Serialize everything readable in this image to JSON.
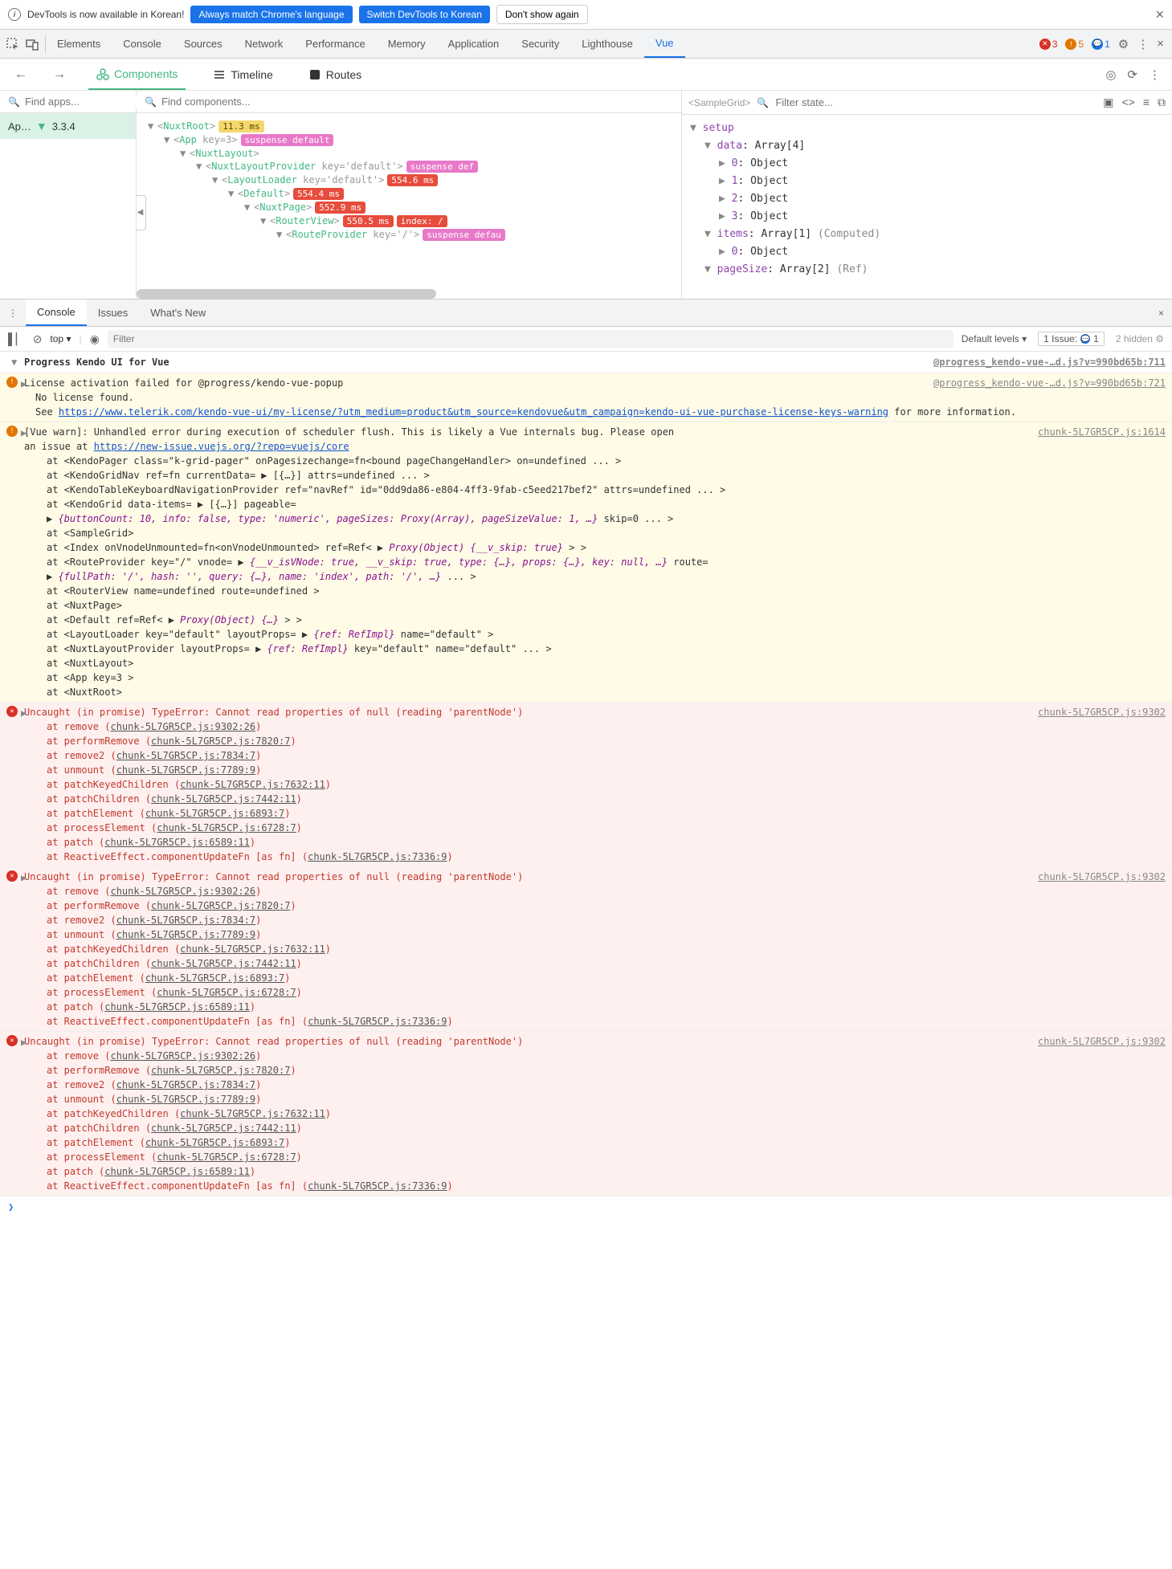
{
  "infobar": {
    "text": "DevTools is now available in Korean!",
    "btn1": "Always match Chrome's language",
    "btn2": "Switch DevTools to Korean",
    "btn3": "Don't show again"
  },
  "maintabs": [
    "Elements",
    "Console",
    "Sources",
    "Network",
    "Performance",
    "Memory",
    "Application",
    "Security",
    "Lighthouse",
    "Vue"
  ],
  "counts": {
    "err": "3",
    "warn": "5",
    "info": "1"
  },
  "vuetabs": {
    "components": "Components",
    "timeline": "Timeline",
    "routes": "Routes"
  },
  "leftSearch": "Find apps...",
  "midSearch": "Find components...",
  "appLabel": "Ap…",
  "appVer": "3.3.4",
  "tree": [
    {
      "indent": 0,
      "name": "NuxtRoot",
      "pills": [
        {
          "cls": "pill-yellow",
          "t": "11.3 ms"
        }
      ]
    },
    {
      "indent": 1,
      "name": "App",
      "key": "key=3",
      "pills": [
        {
          "cls": "pill-pink",
          "t": "suspense default"
        }
      ]
    },
    {
      "indent": 2,
      "name": "NuxtLayout"
    },
    {
      "indent": 3,
      "name": "NuxtLayoutProvider",
      "key": "key='default'",
      "pills": [
        {
          "cls": "pill-pink",
          "t": "suspense def"
        }
      ]
    },
    {
      "indent": 4,
      "name": "LayoutLoader",
      "key": "key='default'",
      "pills": [
        {
          "cls": "pill-red",
          "t": "554.6 ms"
        }
      ]
    },
    {
      "indent": 5,
      "name": "Default",
      "pills": [
        {
          "cls": "pill-red",
          "t": "554.4 ms"
        }
      ]
    },
    {
      "indent": 6,
      "name": "NuxtPage",
      "pills": [
        {
          "cls": "pill-red",
          "t": "552.9 ms"
        }
      ]
    },
    {
      "indent": 7,
      "name": "RouterView",
      "pills": [
        {
          "cls": "pill-red",
          "t": "550.5 ms"
        },
        {
          "cls": "pill-redtxt",
          "t": "index: /"
        }
      ]
    },
    {
      "indent": 8,
      "name": "RouteProvider",
      "key": "key='/'",
      "pills": [
        {
          "cls": "pill-pink",
          "t": "suspense defau"
        }
      ]
    }
  ],
  "stateTitle": "<SampleGrid>",
  "stateSearch": "Filter state...",
  "state": [
    {
      "indent": 0,
      "arrow": "▼",
      "key": "setup",
      "val": ""
    },
    {
      "indent": 1,
      "arrow": "▼",
      "key": "data",
      "val": ": Array[4]"
    },
    {
      "indent": 2,
      "arrow": "▶",
      "key": "0",
      "val": ": Object"
    },
    {
      "indent": 2,
      "arrow": "▶",
      "key": "1",
      "val": ": Object"
    },
    {
      "indent": 2,
      "arrow": "▶",
      "key": "2",
      "val": ": Object"
    },
    {
      "indent": 2,
      "arrow": "▶",
      "key": "3",
      "val": ": Object"
    },
    {
      "indent": 1,
      "arrow": "▼",
      "key": "items",
      "val": ": Array[1] ",
      "extra": "(Computed)"
    },
    {
      "indent": 2,
      "arrow": "▶",
      "key": "0",
      "val": ": Object"
    },
    {
      "indent": 1,
      "arrow": "▼",
      "key": "pageSize",
      "val": ": Array[2] ",
      "extra": "(Ref)"
    }
  ],
  "drawertabs": [
    "Console",
    "Issues",
    "What's New"
  ],
  "ct": {
    "top": "top",
    "filter": "Filter",
    "levels": "Default levels",
    "issue": "1 Issue:",
    "issuecount": "1",
    "hidden": "2 hidden"
  },
  "group": {
    "title": "Progress Kendo UI for Vue",
    "src": "@progress_kendo-vue-…d.js?v=990bd65b:711"
  },
  "warn1": {
    "head": "License activation failed for @progress/kendo-vue-popup",
    "src": "@progress_kendo-vue-…d.js?v=990bd65b:721",
    "l1": "No license found.",
    "l2a": "See ",
    "l2link": "https://www.telerik.com/kendo-vue-ui/my-license/?utm_medium=product&utm_source=kendovue&utm_campaign=kendo-ui-vue-purchase-license-keys-warning",
    "l2b": " for more information."
  },
  "warn2": {
    "head": "[Vue warn]: Unhandled error during execution of scheduler flush. This is likely a Vue internals bug. Please open ",
    "src": "chunk-5L7GR5CP.js:1614",
    "head2": "an issue at ",
    "headlink": "https://new-issue.vuejs.org/?repo=vuejs/core",
    "lines": [
      "at <KendoPager class=\"k-grid-pager\" onPagesizechange=fn<bound pageChangeHandler> on=undefined  ... >",
      "at <KendoGridNav ref=fn currentData= ▶ [{…}] attrs=undefined  ... >",
      "at <KendoTableKeyboardNavigationProvider ref=\"navRef\" id=\"0dd9da86-e804-4ff3-9fab-c5eed217bef2\" attrs=undefined  ... >",
      "at <KendoGrid data-items= ▶ [{…}] pageable="
    ],
    "obj1_pre": "▶ ",
    "obj1": "{buttonCount: 10, info: false, type: 'numeric', pageSizes: Proxy(Array), pageSizeValue: 1, …}",
    "obj1_post": " skip=0  ... >",
    "lines2": [
      "at <SampleGrid>"
    ],
    "idx": "at <Index onVnodeUnmounted=fn<onVnodeUnmounted> ref=Ref< ▶ ",
    "idx_obj": "Proxy(Object) {__v_skip: true}",
    "idx_post": " > >",
    "rp": "at <RouteProvider key=\"/\" vnode= ▶ ",
    "rp_obj": "{__v_isVNode: true, __v_skip: true, type: {…}, props: {…}, key: null, …}",
    "rp_post": " route=",
    "fp_pre": "▶ ",
    "fp": "{fullPath: '/', hash: '', query: {…}, name: 'index', path: '/', …}",
    "fp_post": "  ... >",
    "lines3": [
      "at <RouterView name=undefined route=undefined >",
      "at <NuxtPage>"
    ],
    "def": "at <Default ref=Ref< ▶ ",
    "def_obj": "Proxy(Object) {…}",
    "def_post": " > >",
    "ll": "at <LayoutLoader key=\"default\" layoutProps= ▶ ",
    "ll_obj": "{ref: RefImpl}",
    "ll_post": " name=\"default\" >",
    "nlp": "at <NuxtLayoutProvider layoutProps= ▶ ",
    "nlp_obj": "{ref: RefImpl}",
    "nlp_post": " key=\"default\" name=\"default\"  ... >",
    "lines4": [
      "at <NuxtLayout>",
      "at <App key=3 >",
      "at <NuxtRoot>"
    ]
  },
  "err": {
    "head": "Uncaught (in promise) TypeError: Cannot read properties of null (reading 'parentNode')",
    "src": "chunk-5L7GR5CP.js:9302",
    "stack": [
      {
        "fn": "remove",
        "loc": "chunk-5L7GR5CP.js:9302:26"
      },
      {
        "fn": "performRemove",
        "loc": "chunk-5L7GR5CP.js:7820:7"
      },
      {
        "fn": "remove2",
        "loc": "chunk-5L7GR5CP.js:7834:7"
      },
      {
        "fn": "unmount",
        "loc": "chunk-5L7GR5CP.js:7789:9"
      },
      {
        "fn": "patchKeyedChildren",
        "loc": "chunk-5L7GR5CP.js:7632:11"
      },
      {
        "fn": "patchChildren",
        "loc": "chunk-5L7GR5CP.js:7442:11"
      },
      {
        "fn": "patchElement",
        "loc": "chunk-5L7GR5CP.js:6893:7"
      },
      {
        "fn": "processElement",
        "loc": "chunk-5L7GR5CP.js:6728:7"
      },
      {
        "fn": "patch",
        "loc": "chunk-5L7GR5CP.js:6589:11"
      },
      {
        "fn": "ReactiveEffect.componentUpdateFn [as fn]",
        "loc": "chunk-5L7GR5CP.js:7336:9"
      }
    ]
  }
}
